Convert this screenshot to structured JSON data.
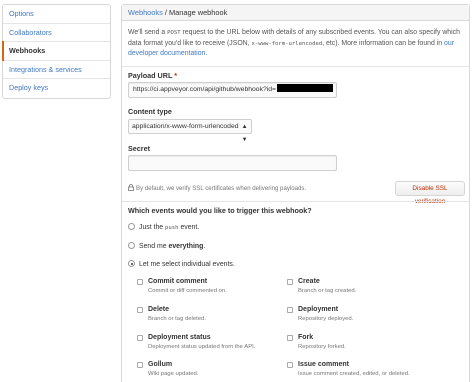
{
  "sidebar": {
    "items": [
      {
        "label": "Options"
      },
      {
        "label": "Collaborators"
      },
      {
        "label": "Webhooks"
      },
      {
        "label": "Integrations & services"
      },
      {
        "label": "Deploy keys"
      }
    ]
  },
  "header": {
    "breadcrumb_link": "Webhooks",
    "breadcrumb_sep": " / ",
    "breadcrumb_current": "Manage webhook"
  },
  "intro": {
    "part1": "We'll send a ",
    "code1": "POST",
    "part2": " request to the URL below with details of any subscribed events. You can also specify which data format you'd like to receive (JSON, ",
    "code2": "x-www-form-urlencoded",
    "part3": ", etc). More information can be found in ",
    "link": "our developer documentation",
    "part4": "."
  },
  "payload": {
    "label": "Payload URL",
    "required_mark": "*",
    "value": "https://ci.appveyor.com/api/github/webhook?id="
  },
  "content_type": {
    "label": "Content type",
    "selected": "application/x-www-form-urlencoded"
  },
  "secret": {
    "label": "Secret",
    "value": ""
  },
  "ssl": {
    "note": "By default, we verify SSL certificates when delivering payloads.",
    "button": "Disable SSL verification"
  },
  "events": {
    "question": "Which events would you like to trigger this webhook?",
    "opt_push_pre": "Just the ",
    "opt_push_code": "push",
    "opt_push_post": " event.",
    "opt_all_pre": "Send me ",
    "opt_all_bold": "everything",
    "opt_all_post": ".",
    "opt_select": "Let me select individual events.",
    "items": [
      {
        "title": "Commit comment",
        "desc": "Commit or diff commented on."
      },
      {
        "title": "Create",
        "desc": "Branch or tag created."
      },
      {
        "title": "Delete",
        "desc": "Branch or tag deleted."
      },
      {
        "title": "Deployment",
        "desc": "Repository deployed."
      },
      {
        "title": "Deployment status",
        "desc": "Deployment status updated from the API."
      },
      {
        "title": "Fork",
        "desc": "Repository forked."
      },
      {
        "title": "Gollum",
        "desc": "Wiki page updated."
      },
      {
        "title": "Issue comment",
        "desc": "Issue comment created, edited, or deleted."
      }
    ]
  },
  "colors": {
    "link": "#4078c0",
    "selected_accent": "#d26911",
    "danger_text": "#bd2c00"
  }
}
